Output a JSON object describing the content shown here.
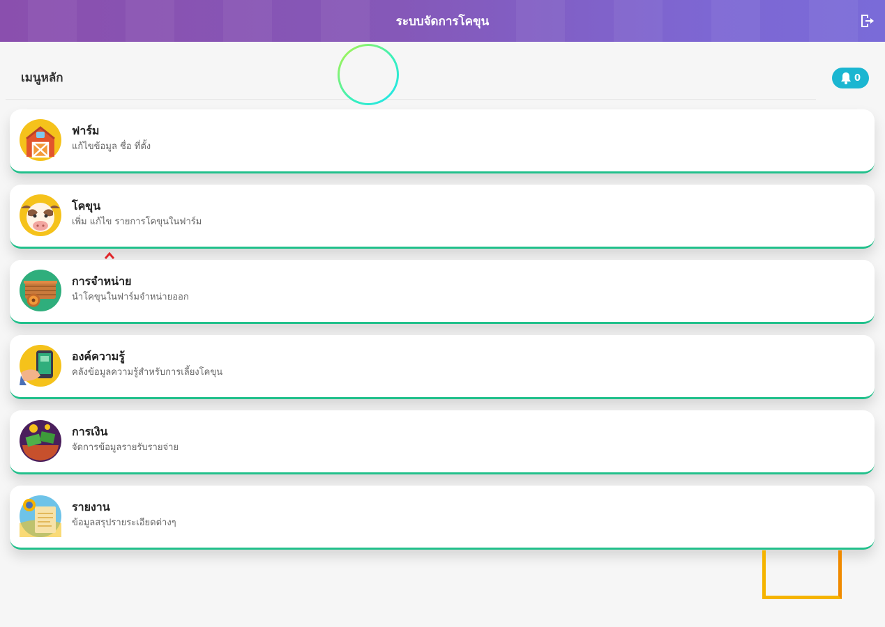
{
  "header": {
    "title": "ระบบจัดการโคขุน"
  },
  "main": {
    "heading": "เมนูหลัก",
    "notification_count": "0",
    "menu_items": [
      {
        "title": "ฟาร์ม",
        "desc": "แก้ไขข้อมูล ชื่อ ที่ตั้ง",
        "icon": "barn-icon"
      },
      {
        "title": "โคขุน",
        "desc": "เพิ่ม แก้ไข รายการโคขุนในฟาร์ม",
        "icon": "cow-icon"
      },
      {
        "title": "การจำหน่าย",
        "desc": "นำโคขุนในฟาร์มจำหน่ายออก",
        "icon": "cart-icon"
      },
      {
        "title": "องค์ความรู้",
        "desc": "คลังข้อมูลความรู้สำหรับการเลี้ยงโคขุน",
        "icon": "tablet-knowledge-icon"
      },
      {
        "title": "การเงิน",
        "desc": "จัดการข้อมูลรายรับรายจ่าย",
        "icon": "money-icon"
      },
      {
        "title": "รายงาน",
        "desc": "ข้อมูลสรุปรายระเอียดต่างๆ",
        "icon": "report-icon"
      }
    ]
  },
  "colors": {
    "header_start": "#8a4fae",
    "header_end": "#7a6bd8",
    "card_accent": "#21c08b",
    "badge": "#1bb6d1"
  }
}
